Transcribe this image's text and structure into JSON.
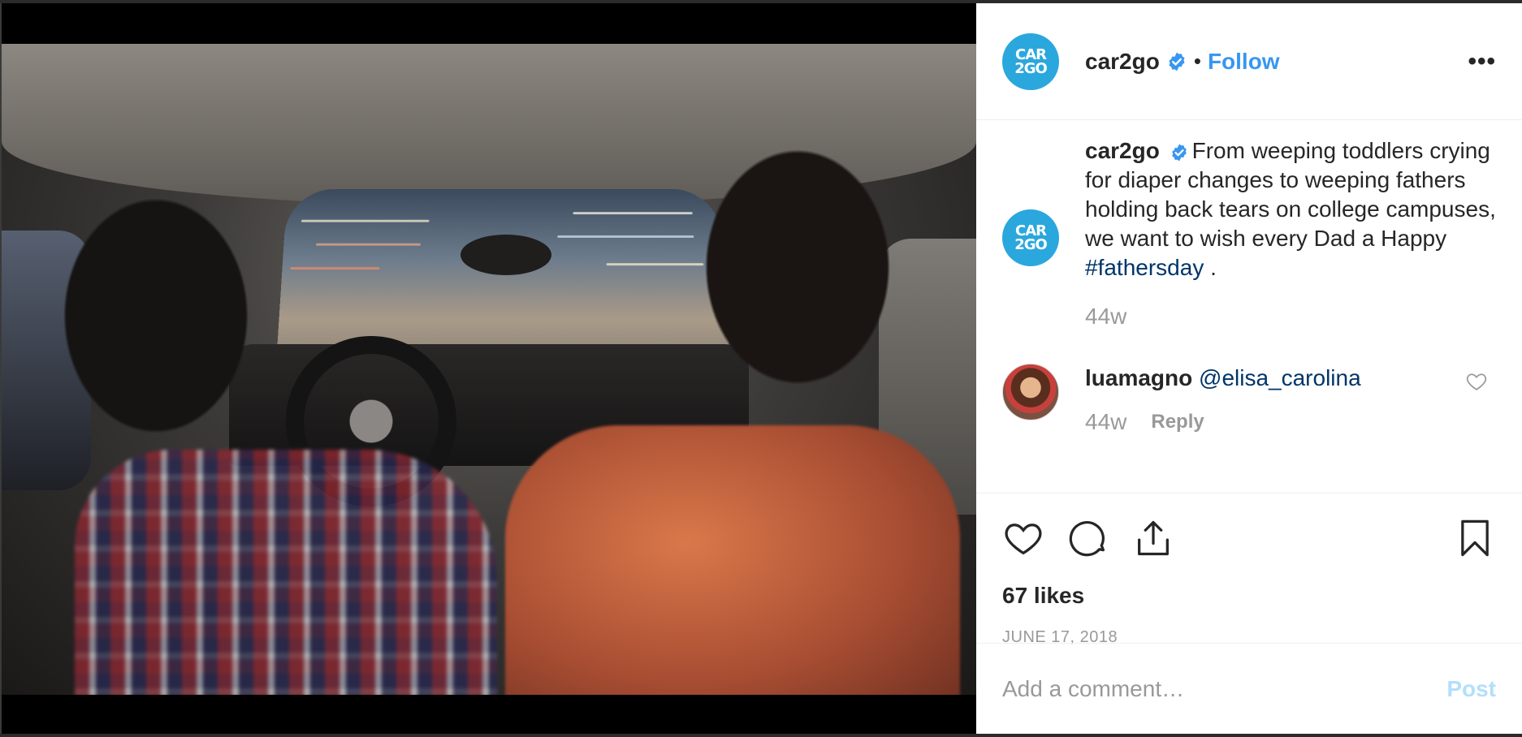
{
  "post": {
    "account": {
      "username": "car2go",
      "avatar_text_line1": "CAR",
      "avatar_text_line2": "2GO",
      "verified": true,
      "follow_label": "Follow",
      "separator": "•",
      "more_label": "•••"
    },
    "caption": {
      "username": "car2go",
      "text": "From weeping toddlers crying for diaper changes to weeping fathers holding back tears on college campuses, we want to wish every Dad a Happy ",
      "hashtag": "#fathersday",
      "text_end": " .",
      "age": "44w"
    },
    "comments": [
      {
        "username": "luamagno",
        "mention": "@elisa_carolina",
        "age": "44w",
        "reply_label": "Reply"
      }
    ],
    "likes": "67 likes",
    "date": "JUNE 17, 2018",
    "add_comment_placeholder": "Add a comment…",
    "post_label": "Post"
  },
  "colors": {
    "accent": "#3897f0",
    "brand": "#2aa7dd",
    "link": "#003569",
    "muted": "#999999"
  },
  "icons": [
    "verified-icon",
    "heart-icon",
    "comment-icon",
    "share-icon",
    "bookmark-icon",
    "more-icon"
  ]
}
